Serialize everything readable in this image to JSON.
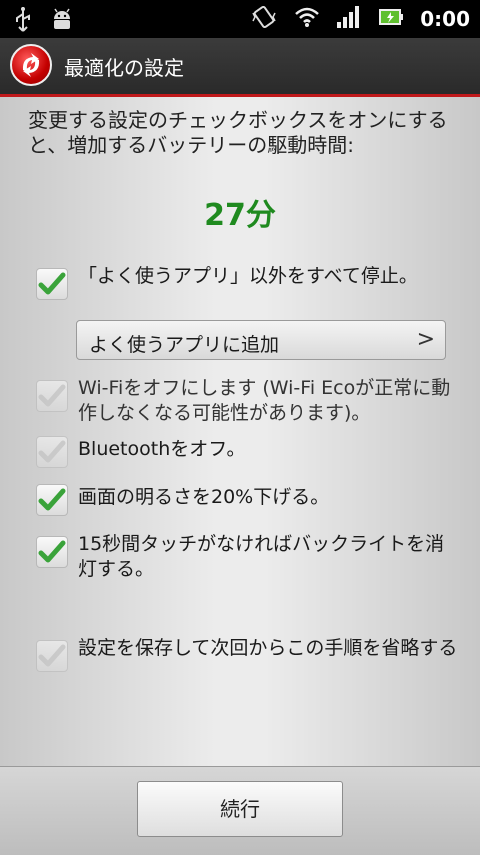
{
  "status_bar": {
    "time": "0:00",
    "icons": [
      "usb-icon",
      "android-debug-icon",
      "vibrate-icon",
      "wifi-icon",
      "signal-icon",
      "battery-charging-icon"
    ]
  },
  "header": {
    "title": "最適化の設定",
    "accent_color": "#c0191b"
  },
  "intro_text": "変更する設定のチェックボックスをオンにすると、増加するバッテリーの駆動時間:",
  "minutes_gained": "27分",
  "options": [
    {
      "label": "「よく使うアプリ」以外をすべて停止。",
      "checked": true,
      "enabled": true
    },
    {
      "label": "Wi-Fiをオフにします (Wi-Fi Ecoが正常に動作しなくなる可能性があります)。",
      "checked": true,
      "enabled": false
    },
    {
      "label": "Bluetoothをオフ。",
      "checked": true,
      "enabled": false
    },
    {
      "label": "画面の明るさを20%下げる。",
      "checked": true,
      "enabled": true
    },
    {
      "label": "15秒間タッチがなければバックライトを消灯する。",
      "checked": true,
      "enabled": true
    }
  ],
  "add_app_button": {
    "label": "よく使うアプリに追加",
    "arrow": ">"
  },
  "save_option": {
    "label": "設定を保存して次回からこの手順を省略する",
    "checked": true,
    "enabled": false
  },
  "continue_button": {
    "label": "続行"
  },
  "colors": {
    "check_green": "#3aa33a",
    "minutes_green": "#1f8a1f"
  }
}
